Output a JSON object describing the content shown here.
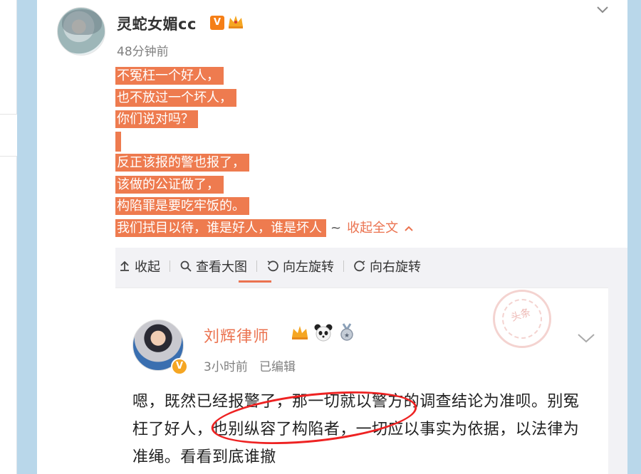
{
  "post": {
    "username": "灵蛇女媚cc",
    "verified_badge": "V",
    "timestamp": "48分钟前",
    "text_lines": [
      "不冤枉一个好人，",
      "也不放过一个坏人，",
      "你们说对吗？",
      "",
      "反正该报的警也报了，",
      "该做的公证做了，",
      "构陷罪是要吃牢饭的。",
      "我们拭目以待，谁是好人，谁是坏人"
    ],
    "tilde": "~",
    "collapse_label": "收起全文",
    "highlight_color": "#ee7b4f"
  },
  "toolbar": {
    "collapse": "收起",
    "view_large": "查看大图",
    "rotate_left": "向左旋转",
    "rotate_right": "向右旋转"
  },
  "quoted": {
    "username": "刘辉律师",
    "verified_badge": "V",
    "timestamp": "3小时前",
    "edited": "已编辑",
    "stamp_text": "头条",
    "text": "嗯，既然已经报警了，那一切就以警方的调查结论为准呗。别冤枉了好人，也别纵容了构陷者，一切应以事实为依据，以法律为准绳。看看到底谁撤",
    "icons": [
      "crown-icon",
      "panda-icon",
      "medal-icon"
    ]
  },
  "colors": {
    "accent": "#eb7350",
    "background": "#b9d7ea"
  }
}
